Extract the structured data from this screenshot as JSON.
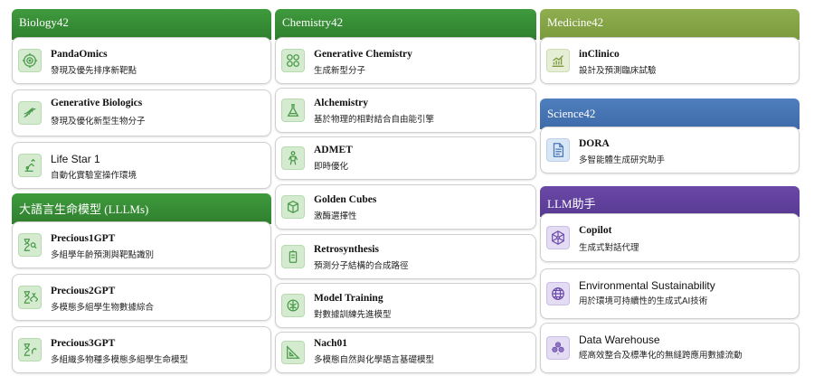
{
  "columns": {
    "left": {
      "sections": [
        {
          "header": "Biology42",
          "items": [
            {
              "title": "PandaOmics",
              "subtitle": "發現及優先排序新靶點",
              "icon": "target-icon"
            },
            {
              "title": "Generative Biologics",
              "subtitle": "發現及優化新型生物分子",
              "icon": "dna-icon"
            },
            {
              "title": "Life Star 1",
              "subtitle": "自動化實驗室操作環境",
              "icon": "robot-arm-icon"
            }
          ]
        },
        {
          "header": "大語言生命模型 (LLLMs)",
          "items": [
            {
              "title": "Precious1GPT",
              "subtitle": "多組學年齡預測與靶點識別",
              "icon": "hourglass-search-icon"
            },
            {
              "title": "Precious2GPT",
              "subtitle": "多模態多組學生物數據綜合",
              "icon": "hourglass-dna-icon"
            },
            {
              "title": "Precious3GPT",
              "subtitle": "多組織多物種多模態多組學生命模型",
              "icon": "hourglass-arm-icon"
            }
          ]
        }
      ]
    },
    "middle": {
      "header": "Chemistry42",
      "items": [
        {
          "title": "Generative Chemistry",
          "subtitle": "生成新型分子",
          "icon": "molecule-icon"
        },
        {
          "title": "Alchemistry",
          "subtitle": "基於物理的相對結合自由能引擎",
          "icon": "flask-icon"
        },
        {
          "title": "ADMET",
          "subtitle": "即時優化",
          "icon": "human-body-icon"
        },
        {
          "title": "Golden Cubes",
          "subtitle": "激酶選擇性",
          "icon": "cube-icon"
        },
        {
          "title": "Retrosynthesis",
          "subtitle": "預測分子結構的合成路徑",
          "icon": "synthesis-icon"
        },
        {
          "title": "Model Training",
          "subtitle": "對數據訓練先進模型",
          "icon": "brain-icon"
        },
        {
          "title": "Nach01",
          "subtitle": "多模態自然與化學語言基礎模型",
          "icon": "triangle-ruler-icon"
        }
      ]
    },
    "right": {
      "sections": [
        {
          "header": "Medicine42",
          "items": [
            {
              "title": "inClinico",
              "subtitle": "設計及預測臨床試驗",
              "icon": "bar-chart-icon"
            }
          ]
        },
        {
          "header": "Science42",
          "items": [
            {
              "title": "DORA",
              "subtitle": "多智能體生成研究助手",
              "icon": "document-icon"
            }
          ]
        },
        {
          "header": "LLM助手",
          "items": [
            {
              "title": "Copilot",
              "subtitle": "生成式對話代理",
              "icon": "network-hex-icon"
            },
            {
              "title": "Environmental Sustainability",
              "subtitle": "用於環境可持續性的生成式AI技術",
              "icon": "globe-icon"
            },
            {
              "title": "Data Warehouse",
              "subtitle": "經高效整合及標準化的無縫跨應用數據流動",
              "icon": "database-cluster-icon"
            }
          ]
        }
      ]
    }
  }
}
